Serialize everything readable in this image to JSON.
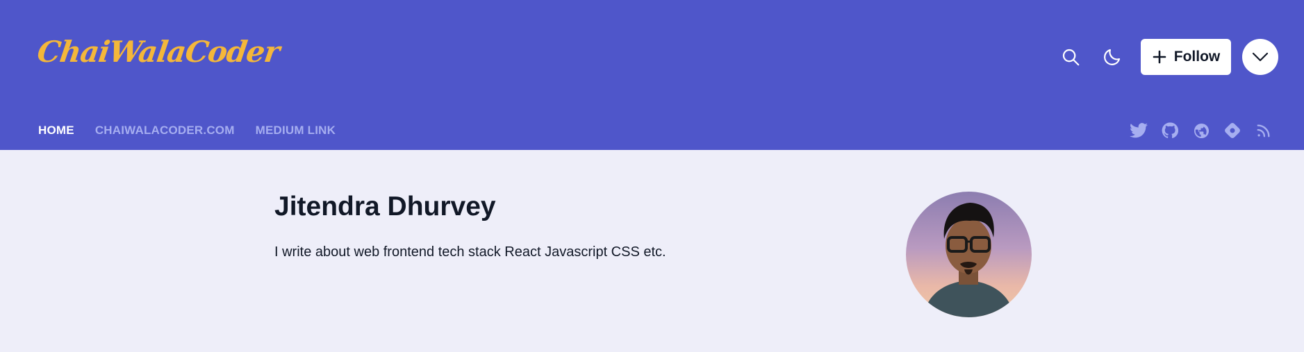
{
  "header": {
    "logo_text": "ChaiWalaCoder",
    "follow_label": "Follow"
  },
  "nav": {
    "items": [
      {
        "label": "HOME",
        "active": true
      },
      {
        "label": "CHAIWALACODER.COM",
        "active": false
      },
      {
        "label": "MEDIUM LINK",
        "active": false
      }
    ]
  },
  "socials": [
    "twitter-icon",
    "github-icon",
    "globe-icon",
    "hashnode-icon",
    "rss-icon"
  ],
  "profile": {
    "name": "Jitendra Dhurvey",
    "bio": "I write about web frontend tech stack React Javascript CSS etc."
  },
  "colors": {
    "header_bg": "#4f56ca",
    "logo": "#f4b73a",
    "nav_inactive": "#a6aef0",
    "page_bg": "#eeeef9"
  }
}
